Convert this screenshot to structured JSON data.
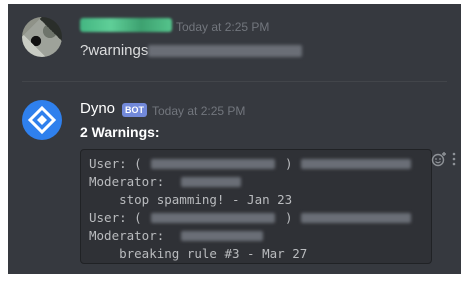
{
  "message1": {
    "timestamp": "Today at 2:25 PM",
    "text": "?warnings"
  },
  "message2": {
    "author": "Dyno",
    "bot_tag": "BOT",
    "timestamp": "Today at 2:25 PM",
    "title": "2 Warnings:",
    "lines": [
      "User: (",
      ")",
      "Moderator:",
      "    stop spamming! - Jan 23",
      "User: (",
      ")",
      "Moderator:",
      "    breaking rule #3 - Mar 27"
    ]
  },
  "icons": {
    "reaction": "add-reaction-icon",
    "more": "more-icon"
  },
  "colors": {
    "background": "#36393f",
    "code_background": "#2f3136",
    "bot_tag": "#7289da",
    "dyno_avatar": "#2f80ed"
  }
}
